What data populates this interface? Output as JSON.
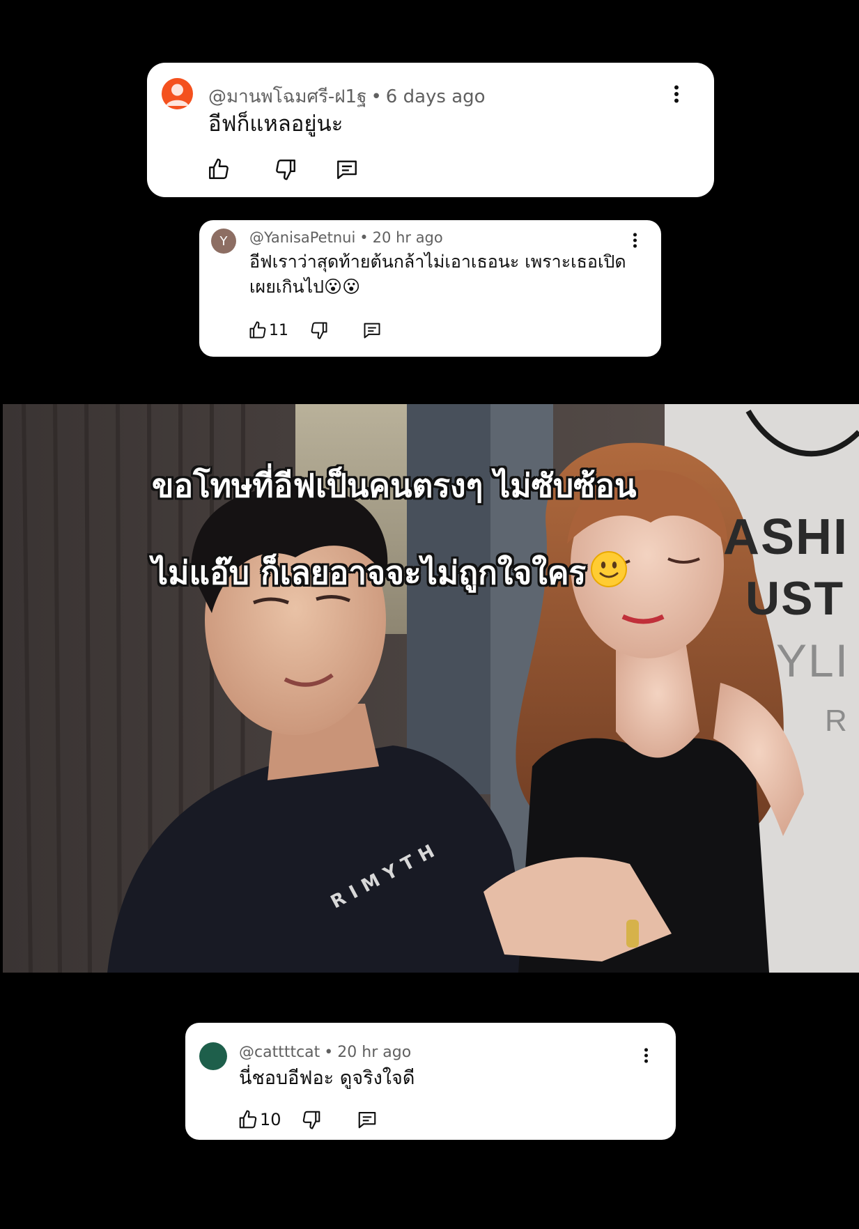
{
  "comments": [
    {
      "avatar_initial": "",
      "avatar_color": "#f4511e",
      "username": "@มานพโฉมศรี-ฝ1ฐ",
      "time": "6 days ago",
      "text": "อีฟก็แหลอยู่นะ",
      "like_count": "",
      "icons": [
        "thumb-up-icon",
        "thumb-down-icon",
        "reply-icon",
        "more-vert-icon"
      ]
    },
    {
      "avatar_initial": "Y",
      "avatar_color": "#8d6e63",
      "username": "@YanisaPetnui",
      "time": "20 hr ago",
      "text": "อีฟเราว่าสุดท้ายต้นกล้าไม่เอาเธอนะ เพราะเธอเปิดเผยเกินไป😮😮",
      "like_count": "11",
      "icons": [
        "thumb-up-icon",
        "thumb-down-icon",
        "reply-icon",
        "more-vert-icon"
      ]
    },
    {
      "avatar_initial": "",
      "avatar_color": "#1e5f4b",
      "username": "@cattttcat",
      "time": "20 hr ago",
      "text": "นี่ชอบอีฟอะ ดูจริงใจดี",
      "like_count": "10",
      "icons": [
        "thumb-up-icon",
        "thumb-down-icon",
        "reply-icon",
        "more-vert-icon"
      ]
    }
  ],
  "video": {
    "caption_line1": "ขอโทษที่อีฟเป็นคนตรงๆ ไม่ซับซ้อน",
    "caption_line2": "ไม่แอ๊บ ก็เลยอาจจะไม่ถูกใจใคร",
    "caption_emoji": "slightly-smiling-face-emoji",
    "backdrop_text": [
      "ASHI",
      "UST",
      "YLI",
      "R"
    ],
    "shirt_text": "RIMYTH"
  },
  "colors": {
    "background": "#000000",
    "card": "#ffffff",
    "meta_text": "#606060",
    "body_text": "#0f0f0f"
  }
}
